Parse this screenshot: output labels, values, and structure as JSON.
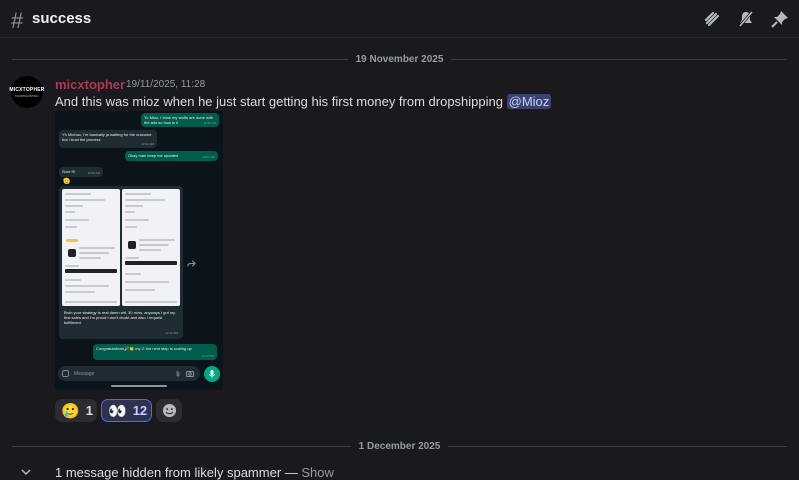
{
  "header": {
    "channel_name": "success",
    "icons": [
      "threads-icon",
      "mute-icon",
      "pin-icon"
    ]
  },
  "dividers": {
    "first": "19 November 2025",
    "second": "1 December 2025"
  },
  "message": {
    "avatar_text": "MICXTOPHER",
    "avatar_subtext": "DROPSHIPPING",
    "author": "micxtopher",
    "timestamp": "19/11/2025, 11:28",
    "text": "And this was mioz when he just start getting his first money from dropshipping",
    "mention": "@Mioz",
    "author_color": "#a83a56"
  },
  "attachment": {
    "bubbles": [
      {
        "text": "Yo Mioz, I think my stuffs are done with the ads so how is it",
        "time": "11:56 AM"
      },
      {
        "text": "Yh Michao, I'm basically ja waiting for the outcome but I trust the process",
        "time": "12:02 AM"
      },
      {
        "text": "Okay man keep me updated",
        "time": "12:03 AM"
      },
      {
        "text": "Sure I'll",
        "time": "11:58 AM"
      },
      {
        "text": "Bruh your strategy is real damn wtf, 30 mins, anyways I got my first sales and I'm proud I don't doubt and also I request fulfillment",
        "time": "12:11 PM"
      },
      {
        "text": "Congratulations🎉👏 my G the next step is scaling up",
        "time": "12:12 PM"
      }
    ],
    "input_placeholder": "Message"
  },
  "reactions": [
    {
      "emoji": "🥲",
      "count": "1",
      "me": false
    },
    {
      "emoji": "👀",
      "count": "12",
      "me": true
    }
  ],
  "hidden_notice": {
    "text": "1 message hidden from likely spammer — ",
    "show": "Show"
  },
  "colors": {
    "background": "#1a1a1e",
    "mention_bg": "#3c4270",
    "reaction_active_border": "#5865f2"
  }
}
